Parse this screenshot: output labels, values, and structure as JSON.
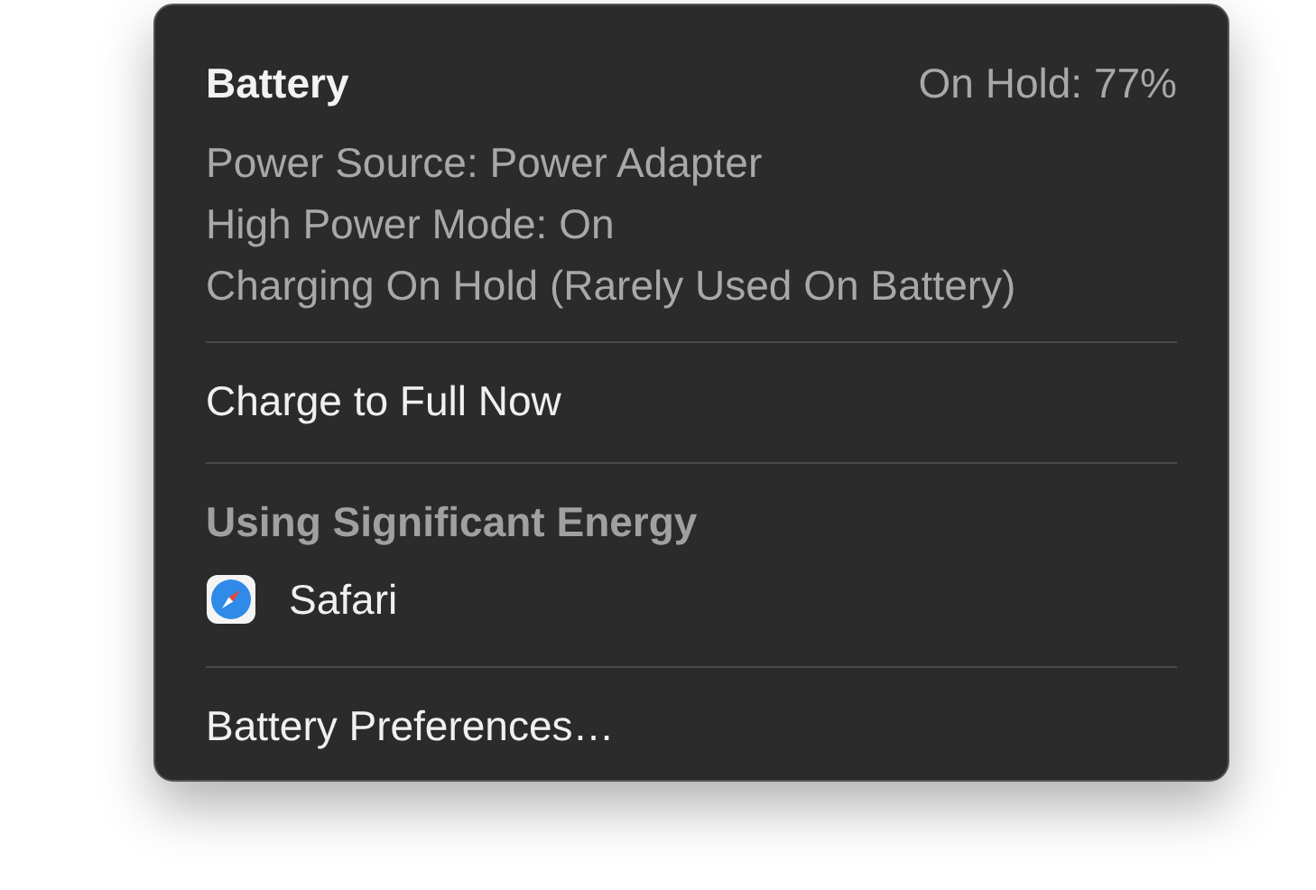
{
  "menu": {
    "title": "Battery",
    "status": "On Hold: 77%",
    "info_lines": [
      "Power Source: Power Adapter",
      "High Power Mode: On",
      "Charging On Hold (Rarely Used On Battery)"
    ],
    "actions": [
      {
        "label": "Charge to Full Now"
      }
    ],
    "section_heading": "Using Significant Energy",
    "apps": [
      {
        "name": "Safari"
      }
    ],
    "footer_item": "Battery Preferences…"
  }
}
